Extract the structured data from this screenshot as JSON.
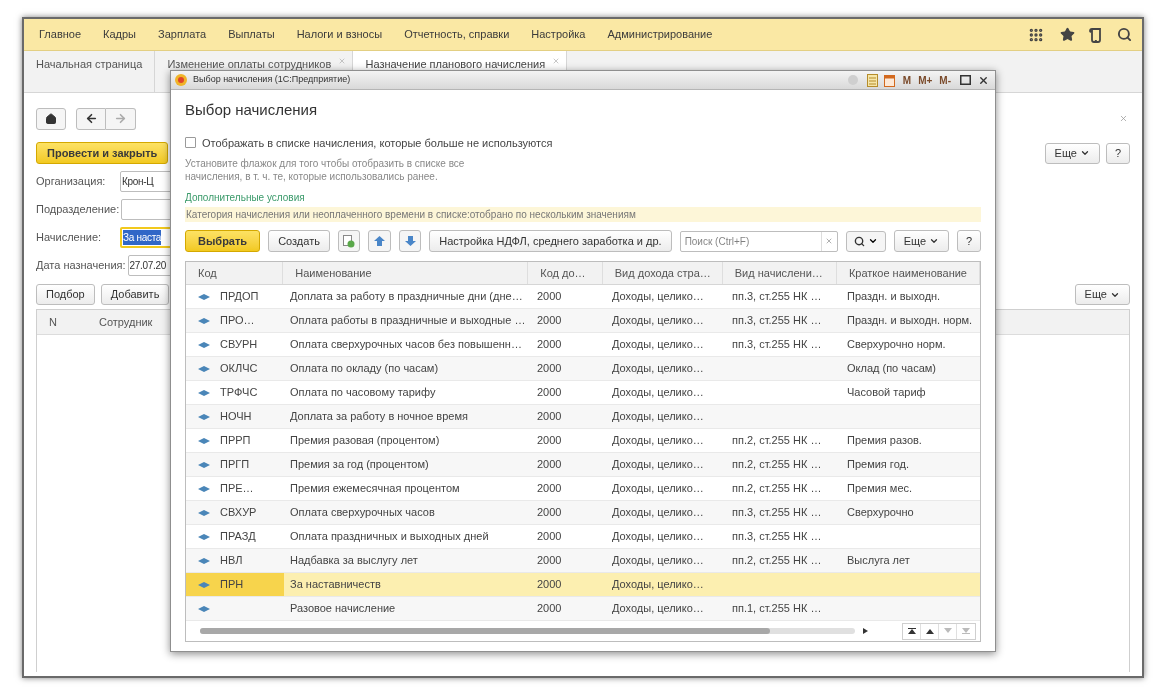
{
  "menu": [
    {
      "label": "Главное"
    },
    {
      "label": "Кадры"
    },
    {
      "label": "Зарплата"
    },
    {
      "label": "Выплаты"
    },
    {
      "label": "Налоги и взносы"
    },
    {
      "label": "Отчетность, справки"
    },
    {
      "label": "Настройка"
    },
    {
      "label": "Администрирование"
    }
  ],
  "tabs": [
    {
      "label": "Начальная страница",
      "selected": false,
      "closable": false
    },
    {
      "label": "Изменение оплаты сотрудников",
      "selected": false,
      "closable": true
    },
    {
      "label": "Назначение планового начисления",
      "selected": true,
      "closable": true
    }
  ],
  "form": {
    "post_button": "Провести и закрыть",
    "more_button": "Еще",
    "help_button": "?",
    "fields": [
      {
        "label": "Организация:",
        "value": "Крон-Ц",
        "focused": false
      },
      {
        "label": "Подразделение:",
        "focused": false
      },
      {
        "label": "Начисление:",
        "value": "За наста",
        "focused": true
      },
      {
        "label": "Дата назначения:",
        "value": "27.07.20",
        "focused": false
      }
    ],
    "buttons": [
      "Подбор",
      "Добавить"
    ],
    "table_more_button": "Еще",
    "columns": [
      "N",
      "Сотрудник"
    ]
  },
  "dialog": {
    "window_title": "Выбор начисления  (1С:Предприятие)",
    "memory_buttons": [
      "M",
      "M+",
      "M-"
    ],
    "title": "Выбор начисления",
    "checkbox": {
      "label": "Отображать в списке начисления, которые больше не используются",
      "checked": false
    },
    "hint": "Установите флажок для того чтобы отобразить в списке все начисления, в т. ч. те, которые использовались ранее.",
    "conditions_link": "Дополнительные условия",
    "filter": "Категория начисления или неоплаченного времени в списке:отобрано по нескольким значениям",
    "toolbar": {
      "select": "Выбрать",
      "create": "Создать",
      "settings": "Настройка НДФЛ, среднего заработка и др.",
      "search_placeholder": "Поиск (Ctrl+F)",
      "more": "Еще",
      "help": "?"
    },
    "columns": [
      "Код",
      "Наименование",
      "Код до…",
      "Вид дохода стра…",
      "Вид начислени…",
      "Краткое наименование"
    ],
    "rows": [
      {
        "code": "ПРДОП",
        "name": "Доплата за работу в праздничные дни (дне…",
        "income_code": "2000",
        "income_type": "Доходы, целико…",
        "accrual_type": "пп.3, ст.255 НК …",
        "short_name": "Праздн. и выходн.",
        "selected": false
      },
      {
        "code": "ПРО…",
        "name": "Оплата работы в праздничные и выходные …",
        "income_code": "2000",
        "income_type": "Доходы, целико…",
        "accrual_type": "пп.3, ст.255 НК …",
        "short_name": "Праздн. и выходн. норм.",
        "selected": false
      },
      {
        "code": "СВУРН",
        "name": "Оплата сверхурочных часов без повышенн…",
        "income_code": "2000",
        "income_type": "Доходы, целико…",
        "accrual_type": "пп.3, ст.255 НК …",
        "short_name": "Сверхурочно норм.",
        "selected": false
      },
      {
        "code": "ОКЛЧС",
        "name": "Оплата по окладу (по часам)",
        "income_code": "2000",
        "income_type": "Доходы, целико…",
        "short_name": "Оклад (по часам)",
        "selected": false
      },
      {
        "code": "ТРФЧС",
        "name": "Оплата по часовому тарифу",
        "income_code": "2000",
        "income_type": "Доходы, целико…",
        "short_name": "Часовой тариф",
        "selected": false
      },
      {
        "code": "НОЧН",
        "name": "Доплата за работу в ночное время",
        "income_code": "2000",
        "income_type": "Доходы, целико…",
        "selected": false
      },
      {
        "code": "ПРРП",
        "name": "Премия разовая (процентом)",
        "income_code": "2000",
        "income_type": "Доходы, целико…",
        "accrual_type": "пп.2, ст.255 НК …",
        "short_name": "Премия разов.",
        "selected": false
      },
      {
        "code": "ПРГП",
        "name": "Премия за год (процентом)",
        "income_code": "2000",
        "income_type": "Доходы, целико…",
        "accrual_type": "пп.2, ст.255 НК …",
        "short_name": "Премия год.",
        "selected": false
      },
      {
        "code": "ПРЕ…",
        "name": "Премия ежемесячная процентом",
        "income_code": "2000",
        "income_type": "Доходы, целико…",
        "accrual_type": "пп.2, ст.255 НК …",
        "short_name": "Премия мес.",
        "selected": false
      },
      {
        "code": "СВХУР",
        "name": "Оплата сверхурочных часов",
        "income_code": "2000",
        "income_type": "Доходы, целико…",
        "accrual_type": "пп.3, ст.255 НК …",
        "short_name": "Сверхурочно",
        "selected": false
      },
      {
        "code": "ПРАЗД",
        "name": "Оплата праздничных и выходных дней",
        "income_code": "2000",
        "income_type": "Доходы, целико…",
        "accrual_type": "пп.3, ст.255 НК …",
        "selected": false
      },
      {
        "code": "НВЛ",
        "name": "Надбавка за выслугу лет",
        "income_code": "2000",
        "income_type": "Доходы, целико…",
        "accrual_type": "пп.2, ст.255 НК …",
        "short_name": "Выслуга лет",
        "selected": false
      },
      {
        "code": "ПРН",
        "name": "За наставничеств",
        "income_code": "2000",
        "income_type": "Доходы, целико…",
        "selected": true
      },
      {
        "name": "Разовое начисление",
        "income_code": "2000",
        "income_type": "Доходы, целико…",
        "accrual_type": "пп.1, ст.255 НК …",
        "selected": false
      }
    ]
  }
}
